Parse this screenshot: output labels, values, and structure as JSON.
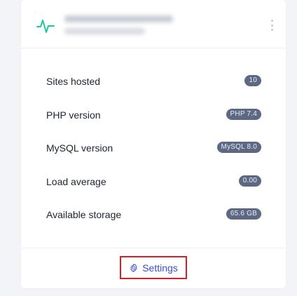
{
  "header": {
    "icon": "activity-pulse-icon",
    "accent_color": "#1cc99a",
    "menu_icon": "kebab-menu-icon"
  },
  "stats": [
    {
      "label": "Sites hosted",
      "value": "10"
    },
    {
      "label": "PHP version",
      "value": "PHP 7.4"
    },
    {
      "label": "MySQL version",
      "value": "MySQL 8.0"
    },
    {
      "label": "Load average",
      "value": "0.00"
    },
    {
      "label": "Available storage",
      "value": "65.6 GB"
    }
  ],
  "footer": {
    "settings_label": "Settings",
    "settings_icon": "gear-icon",
    "link_color": "#3a4bd8",
    "highlight_color": "#d5202a"
  },
  "badge_color": "#5d6883"
}
